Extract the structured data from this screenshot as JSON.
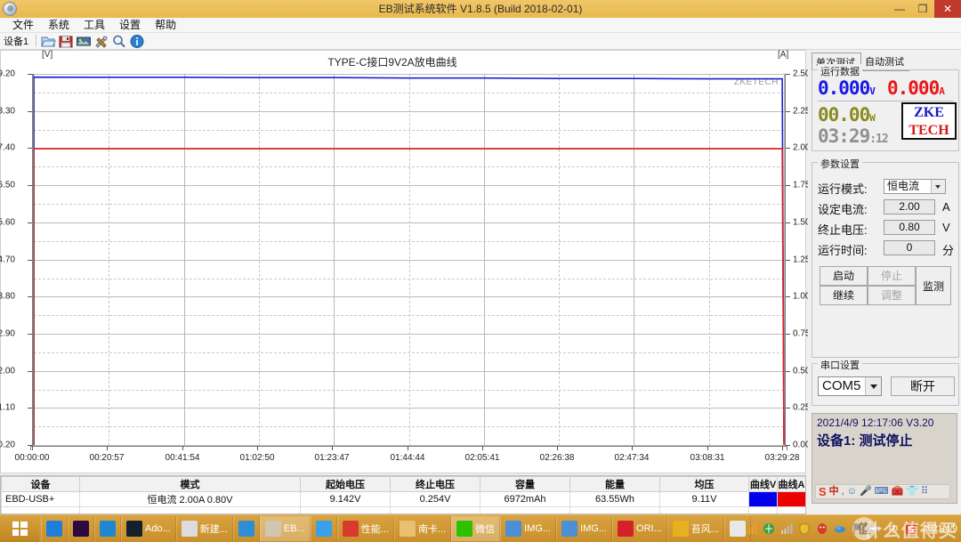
{
  "window": {
    "title": "EB测试系统软件 V1.8.5 (Build 2018-02-01)",
    "minimize": "—",
    "maximize": "❐",
    "close": "✕",
    "sysicon": "app-globe-icon"
  },
  "menu": {
    "items": [
      "文件",
      "系统",
      "工具",
      "设置",
      "帮助"
    ]
  },
  "toolbar": {
    "device_label": "设备1",
    "icons": [
      "open-folder-icon",
      "save-disk-icon",
      "export-image-icon",
      "tools-icon",
      "zoom-search-icon",
      "info-icon"
    ]
  },
  "chart": {
    "title": "TYPE-C接口9V2A放电曲线",
    "left_axis_unit": "[V]",
    "right_axis_unit": "[A]",
    "watermark": "ZKETECH"
  },
  "chart_data": {
    "type": "line",
    "title": "TYPE-C接口9V2A放电曲线",
    "xlabel": "",
    "ylabel": "[V]",
    "y2label": "[A]",
    "grid": true,
    "legend": "none",
    "xlim": [
      "00:00:00",
      "03:29:28"
    ],
    "x_ticks": [
      "00:00:00",
      "00:20:57",
      "00:41:54",
      "01:02:50",
      "01:23:47",
      "01:44:44",
      "02:05:41",
      "02:26:38",
      "02:47:34",
      "03:08:31",
      "03:29:28"
    ],
    "ylim": [
      0.2,
      9.2
    ],
    "y_ticks": [
      "9.20",
      "8.30",
      "7.40",
      "6.50",
      "5.60",
      "4.70",
      "3.80",
      "2.90",
      "2.00",
      "1.10",
      "0.20"
    ],
    "y2lim": [
      0.0,
      2.5
    ],
    "y2_ticks": [
      "2.50",
      "2.25",
      "2.00",
      "1.75",
      "1.50",
      "1.25",
      "1.00",
      "0.75",
      "0.50",
      "0.25",
      "0.00"
    ],
    "series": [
      {
        "name": "曲线V",
        "axis": "left",
        "color": "#2020d0",
        "description": "电压曲线：自 00:00:00 起稳定在约 9.14 V，整个放电过程几乎恒定，至 03:29:28 垂直跌落到 0.25 V 附近",
        "x": [
          "00:00:00",
          "00:20:57",
          "00:41:54",
          "01:02:50",
          "01:23:47",
          "01:44:44",
          "02:05:41",
          "02:26:38",
          "02:47:34",
          "03:08:31",
          "03:29:00",
          "03:29:28"
        ],
        "values": [
          9.142,
          9.14,
          9.14,
          9.13,
          9.13,
          9.12,
          9.12,
          9.11,
          9.11,
          9.1,
          9.1,
          0.254
        ]
      },
      {
        "name": "曲线A",
        "axis": "right",
        "color": "#e02020",
        "description": "电流曲线：恒流 2.00 A 贯穿全程，起止处为垂直跳变",
        "x": [
          "00:00:00",
          "00:20:57",
          "00:41:54",
          "01:02:50",
          "01:23:47",
          "01:44:44",
          "02:05:41",
          "02:26:38",
          "02:47:34",
          "03:08:31",
          "03:29:00",
          "03:29:28"
        ],
        "values": [
          2.0,
          2.0,
          2.0,
          2.0,
          2.0,
          2.0,
          2.0,
          2.0,
          2.0,
          2.0,
          2.0,
          0.0
        ]
      }
    ]
  },
  "table": {
    "headers": [
      "设备",
      "模式",
      "起始电压",
      "终止电压",
      "容量",
      "能量",
      "均压",
      "曲线V",
      "曲线A"
    ],
    "rows": [
      {
        "device": "EBD-USB+",
        "mode": "恒电流 2.00A 0.80V",
        "start_voltage": "9.142V",
        "end_voltage": "0.254V",
        "capacity": "6972mAh",
        "energy": "63.55Wh",
        "avg_voltage": "9.11V",
        "curve_v_color": "#0000ee",
        "curve_a_color": "#ee0000"
      }
    ]
  },
  "right_panel": {
    "tabs": [
      {
        "label": "单次测试",
        "active": true
      },
      {
        "label": "自动测试",
        "active": false
      }
    ],
    "runtime_group": {
      "legend": "运行数据",
      "voltage": "0.000",
      "voltage_unit": "V",
      "current": "0.000",
      "current_unit": "A",
      "power": "00.00",
      "power_unit": "W",
      "elapsed": "03:29",
      "elapsed_seconds": ":12",
      "brand_top": "ZKE",
      "brand_bottom": "TECH"
    },
    "params_group": {
      "legend": "参数设置",
      "mode_label": "运行模式:",
      "mode_value": "恒电流",
      "current_label": "设定电流:",
      "current_value": "2.00",
      "current_unit": "A",
      "cutoff_label": "终止电压:",
      "cutoff_value": "0.80",
      "cutoff_unit": "V",
      "time_label": "运行时间:",
      "time_value": "0",
      "time_unit": "分",
      "buttons": [
        {
          "label": "启动",
          "enabled": true
        },
        {
          "label": "停止",
          "enabled": false
        },
        {
          "label": "继续",
          "enabled": true
        },
        {
          "label": "调整",
          "enabled": false
        },
        {
          "label": "监测",
          "enabled": true
        }
      ]
    },
    "serial_group": {
      "legend": "串口设置",
      "port": "COM5",
      "disconnect_label": "断开"
    },
    "log": {
      "line1": "2021/4/9 12:17:06  V3.20",
      "line2": "设备1: 测试停止",
      "ime_items": [
        "S",
        "中",
        "·,",
        "☺",
        "🎤",
        "⌨",
        "🔧",
        "👕",
        "⠿"
      ]
    }
  },
  "taskbar": {
    "start": "windows-start-icon",
    "tasks": [
      {
        "icon": "sogou-icon",
        "label": "",
        "color": "#1f7fd6",
        "active": false
      },
      {
        "icon": "premiere-icon",
        "label": "",
        "color": "#2a0a40",
        "active": false
      },
      {
        "icon": "browser-icon",
        "label": "",
        "color": "#1f86d0",
        "active": false
      },
      {
        "icon": "photoshop-icon",
        "label": "Ado...",
        "color": "#14202c",
        "active": false
      },
      {
        "icon": "document-icon",
        "label": "新建...",
        "color": "#dcdcdc",
        "active": false
      },
      {
        "icon": "kingsoft-icon",
        "label": "",
        "color": "#2d8ed6",
        "active": false
      },
      {
        "icon": "eb-software-icon",
        "label": "EB...",
        "color": "#cfc6b0",
        "active": true
      },
      {
        "icon": "bird-icon",
        "label": "",
        "color": "#3aa0e8",
        "active": false
      },
      {
        "icon": "chrome-icon",
        "label": "性能...",
        "color": "#d63b2f",
        "active": false
      },
      {
        "icon": "folder-icon",
        "label": "南卡...",
        "color": "#e8c070",
        "active": false
      },
      {
        "icon": "wechat-icon",
        "label": "微信",
        "color": "#2dc100",
        "active": true
      },
      {
        "icon": "image-icon",
        "label": "IMG...",
        "color": "#4d8fd6",
        "active": false
      },
      {
        "icon": "image-icon",
        "label": "IMG...",
        "color": "#4d8fd6",
        "active": false
      },
      {
        "icon": "opera-icon",
        "label": "ORI...",
        "color": "#d6202c",
        "active": false
      },
      {
        "icon": "avatar-icon",
        "label": "苔风...",
        "color": "#e8b020",
        "active": false
      },
      {
        "icon": "keyboard-icon",
        "label": "",
        "color": "#e8e8e8",
        "active": false
      }
    ],
    "tray": [
      "signal-icon",
      "network-icon",
      "signal2-icon",
      "shield-icon",
      "qq-icon",
      "cloud-icon",
      "flag-icon",
      "volume-icon",
      "ime-cn-icon",
      "sogou-s-icon"
    ],
    "date": "2021/4/9",
    "watermark_badge": "值",
    "watermark_text": "什么值得买"
  }
}
